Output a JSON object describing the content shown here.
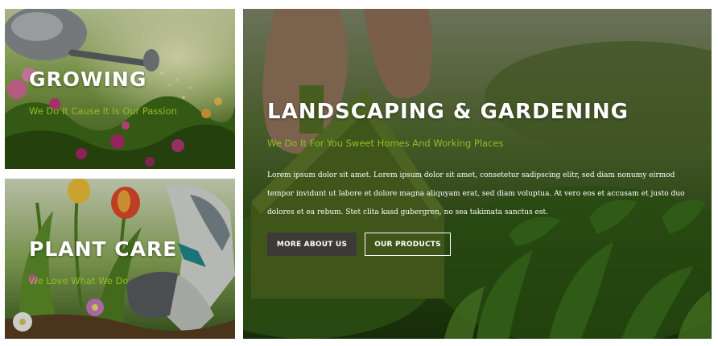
{
  "panels": {
    "growing": {
      "title": "GROWING",
      "tagline": "We Do It Cause It Is Our Passion"
    },
    "plant_care": {
      "title": "PLANT CARE",
      "tagline": "We Love What We Do"
    },
    "landscaping": {
      "title": "LANDSCAPING & GARDENING",
      "tagline": "We Do It For You Sweet Homes And Working Places",
      "body": "Lorem ipsum dolor sit amet. Lorem ipsum dolor sit amet, consetetur sadipscing elitr, sed diam nonumy eirmod tempor invidunt ut labore et dolore magna aliquyam erat, sed diam voluptua. At vero eos et accusam et justo duo dolores et ea rebum. Stet clita kasd gubergren, no sea takimata sanctus est.",
      "buttons": {
        "about": "MORE ABOUT US",
        "products": "OUR PRODUCTS"
      }
    }
  },
  "colors": {
    "accent_green": "#8fbe21",
    "button_dark": "#3c3a37",
    "text_white": "#ffffff"
  }
}
